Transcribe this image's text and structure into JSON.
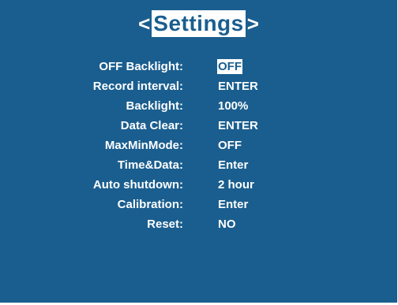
{
  "header": {
    "title": "Settings",
    "prev_arrow": "<",
    "next_arrow": ">"
  },
  "menu": {
    "items": [
      {
        "label": "OFF Backlight:",
        "value": "OFF",
        "selected": true
      },
      {
        "label": "Record interval:",
        "value": "ENTER"
      },
      {
        "label": "Backlight:",
        "value": "100%"
      },
      {
        "label": "Data Clear:",
        "value": "ENTER"
      },
      {
        "label": "MaxMinMode:",
        "value": "OFF"
      },
      {
        "label": "Time&Data:",
        "value": "Enter"
      },
      {
        "label": "Auto shutdown:",
        "value": "2 hour"
      },
      {
        "label": "Calibration:",
        "value": "Enter"
      },
      {
        "label": "Reset:",
        "value": "NO"
      }
    ]
  },
  "colors": {
    "background": "#1a5e8f",
    "text": "#ffffff",
    "highlight": "#ffffff"
  }
}
